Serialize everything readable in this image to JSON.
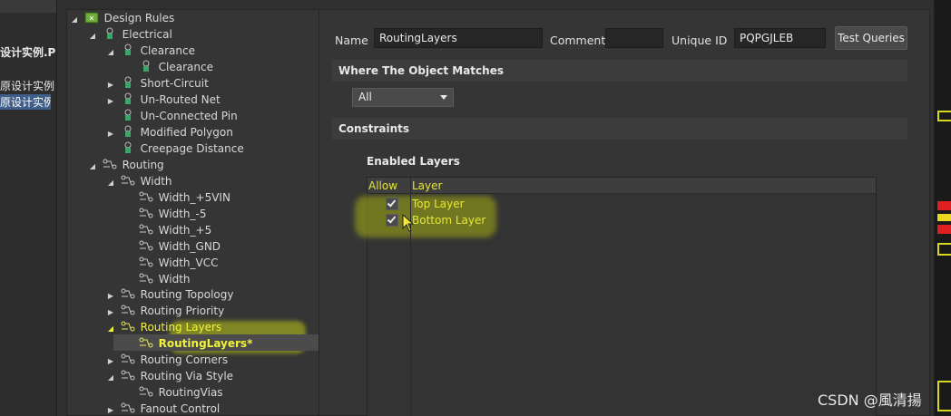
{
  "background_window": {
    "items": [
      {
        "text": "设计实例.P",
        "bold": true
      },
      {
        "text": "原设计实例",
        "bold": false
      },
      {
        "text": "原设计实例",
        "bold": false,
        "selected": true
      }
    ]
  },
  "tree": {
    "root": "Design Rules",
    "electrical": "Electrical",
    "clearance_group": "Clearance",
    "clearance_rule": "Clearance",
    "short_circuit": "Short-Circuit",
    "unrouted_net": "Un-Routed Net",
    "unconnected_pin": "Un-Connected Pin",
    "modified_polygon": "Modified Polygon",
    "creepage_distance": "Creepage Distance",
    "routing": "Routing",
    "width": "Width",
    "width_rules": [
      "Width_+5VIN",
      "Width_-5",
      "Width_+5",
      "Width_GND",
      "Width_VCC",
      "Width"
    ],
    "routing_topology": "Routing Topology",
    "routing_priority": "Routing Priority",
    "routing_layers": "Routing Layers",
    "routing_layers_rule": "RoutingLayers*",
    "routing_corners": "Routing Corners",
    "routing_via_style": "Routing Via Style",
    "routing_vias": "RoutingVias",
    "fanout_control": "Fanout Control"
  },
  "form": {
    "name_label": "Name",
    "name_value": "RoutingLayers",
    "comment_label": "Comment",
    "comment_value": "",
    "uid_label": "Unique ID",
    "uid_value": "PQPGJLEB",
    "test_queries": "Test Queries"
  },
  "where_section": "Where The Object Matches",
  "match_combo": "All",
  "constraints_section": "Constraints",
  "enabled_layers_title": "Enabled Layers",
  "layers_table": {
    "col_allow": "Allow ...",
    "col_layer": "Layer",
    "rows": [
      {
        "checked": true,
        "layer": "Top Layer"
      },
      {
        "checked": true,
        "layer": "Bottom Layer"
      }
    ]
  },
  "watermark": "CSDN @風清揚",
  "colors": {
    "highlight_text": "#f2f23a",
    "selection": "#3f5f8a",
    "panel": "#353535"
  }
}
